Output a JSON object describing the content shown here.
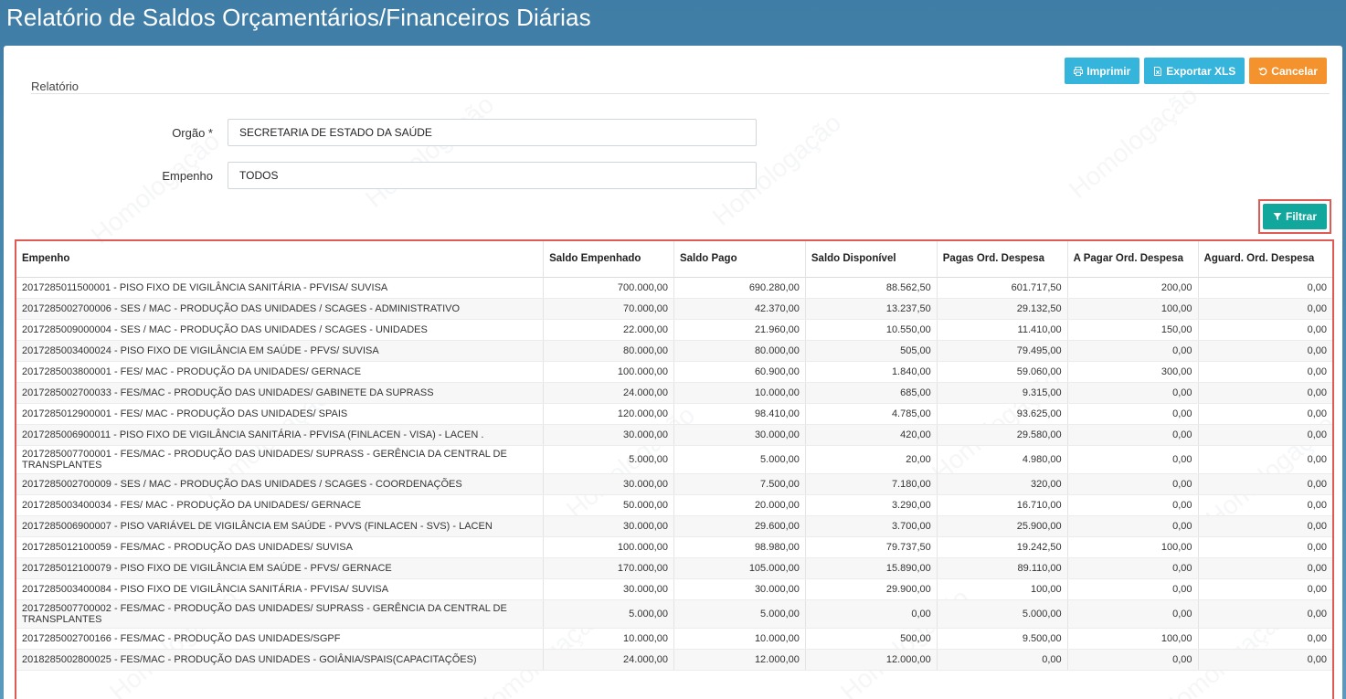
{
  "page_title": "Relatório de Saldos Orçamentários/Financeiros Diárias",
  "panel_heading": "Relatório",
  "watermark": "Homologação",
  "toolbar": {
    "print_label": "Imprimir",
    "export_label": "Exportar XLS",
    "cancel_label": "Cancelar"
  },
  "form": {
    "orgao_label": "Orgão *",
    "orgao_value": "SECRETARIA DE ESTADO DA SAÚDE",
    "empenho_label": "Empenho",
    "empenho_value": "TODOS"
  },
  "filter_label": "Filtrar",
  "table": {
    "headers": [
      "Empenho",
      "Saldo Empenhado",
      "Saldo Pago",
      "Saldo Disponível",
      "Pagas Ord. Despesa",
      "A Pagar Ord. Despesa",
      "Aguard. Ord. Despesa"
    ],
    "rows": [
      [
        "2017285011500001 - PISO FIXO DE VIGILÂNCIA SANITÁRIA - PFVISA/ SUVISA",
        "700.000,00",
        "690.280,00",
        "88.562,50",
        "601.717,50",
        "200,00",
        "0,00"
      ],
      [
        "2017285002700006 - SES / MAC - PRODUÇÃO DAS UNIDADES / SCAGES - ADMINISTRATIVO",
        "70.000,00",
        "42.370,00",
        "13.237,50",
        "29.132,50",
        "100,00",
        "0,00"
      ],
      [
        "2017285009000004 - SES / MAC - PRODUÇÃO DAS UNIDADES / SCAGES - UNIDADES",
        "22.000,00",
        "21.960,00",
        "10.550,00",
        "11.410,00",
        "150,00",
        "0,00"
      ],
      [
        "2017285003400024 - PISO FIXO DE VIGILÂNCIA EM SAÚDE - PFVS/ SUVISA",
        "80.000,00",
        "80.000,00",
        "505,00",
        "79.495,00",
        "0,00",
        "0,00"
      ],
      [
        "2017285003800001 - FES/ MAC - PRODUÇÃO DA UNIDADES/ GERNACE",
        "100.000,00",
        "60.900,00",
        "1.840,00",
        "59.060,00",
        "300,00",
        "0,00"
      ],
      [
        "2017285002700033 - FES/MAC - PRODUÇÃO DAS UNIDADES/ GABINETE DA SUPRASS",
        "24.000,00",
        "10.000,00",
        "685,00",
        "9.315,00",
        "0,00",
        "0,00"
      ],
      [
        "2017285012900001 - FES/ MAC - PRODUÇÃO DAS UNIDADES/ SPAIS",
        "120.000,00",
        "98.410,00",
        "4.785,00",
        "93.625,00",
        "0,00",
        "0,00"
      ],
      [
        "2017285006900011 - PISO FIXO DE VIGILÂNCIA SANITÁRIA - PFVISA (FINLACEN - VISA) - LACEN .",
        "30.000,00",
        "30.000,00",
        "420,00",
        "29.580,00",
        "0,00",
        "0,00"
      ],
      [
        "2017285007700001 - FES/MAC - PRODUÇÃO DAS UNIDADES/ SUPRASS - GERÊNCIA DA CENTRAL DE TRANSPLANTES",
        "5.000,00",
        "5.000,00",
        "20,00",
        "4.980,00",
        "0,00",
        "0,00"
      ],
      [
        "2017285002700009 - SES / MAC - PRODUÇÃO DAS UNIDADES / SCAGES - COORDENAÇÕES",
        "30.000,00",
        "7.500,00",
        "7.180,00",
        "320,00",
        "0,00",
        "0,00"
      ],
      [
        "2017285003400034 - FES/ MAC - PRODUÇÃO DA UNIDADES/ GERNACE",
        "50.000,00",
        "20.000,00",
        "3.290,00",
        "16.710,00",
        "0,00",
        "0,00"
      ],
      [
        "2017285006900007 - PISO VARIÁVEL DE VIGILÂNCIA EM SAÚDE - PVVS (FINLACEN - SVS) - LACEN",
        "30.000,00",
        "29.600,00",
        "3.700,00",
        "25.900,00",
        "0,00",
        "0,00"
      ],
      [
        "2017285012100059 - FES/MAC - PRODUÇÃO DAS UNIDADES/ SUVISA",
        "100.000,00",
        "98.980,00",
        "79.737,50",
        "19.242,50",
        "100,00",
        "0,00"
      ],
      [
        "2017285012100079 - PISO FIXO DE VIGILÂNCIA EM SAÚDE - PFVS/ GERNACE",
        "170.000,00",
        "105.000,00",
        "15.890,00",
        "89.110,00",
        "0,00",
        "0,00"
      ],
      [
        "2017285003400084 - PISO FIXO DE VIGILÂNCIA SANITÁRIA - PFVISA/ SUVISA",
        "30.000,00",
        "30.000,00",
        "29.900,00",
        "100,00",
        "0,00",
        "0,00"
      ],
      [
        "2017285007700002 - FES/MAC - PRODUÇÃO DAS UNIDADES/ SUPRASS - GERÊNCIA DA CENTRAL DE TRANSPLANTES",
        "5.000,00",
        "5.000,00",
        "0,00",
        "5.000,00",
        "0,00",
        "0,00"
      ],
      [
        "2017285002700166 - FES/MAC - PRODUÇÃO DAS UNIDADES/SGPF",
        "10.000,00",
        "10.000,00",
        "500,00",
        "9.500,00",
        "100,00",
        "0,00"
      ],
      [
        "2018285002800025 - FES/MAC - PRODUÇÃO DAS UNIDADES - GOIÂNIA/SPAIS(CAPACITAÇÕES)",
        "24.000,00",
        "12.000,00",
        "12.000,00",
        "0,00",
        "0,00",
        "0,00"
      ]
    ]
  }
}
